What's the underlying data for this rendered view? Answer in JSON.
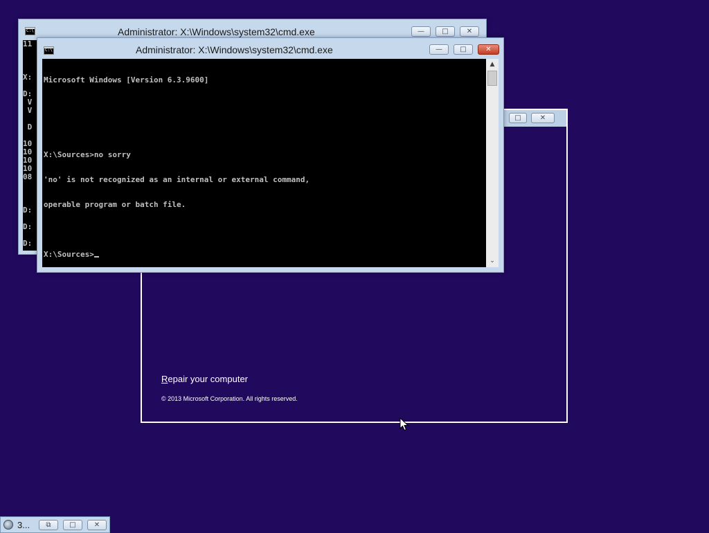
{
  "setup_window": {
    "repair_link_first": "R",
    "repair_link_rest": "epair your computer",
    "copyright": "© 2013 Microsoft Corporation. All rights reserved.",
    "caption_restore": "□",
    "caption_close": "✕"
  },
  "cmd_back": {
    "title": "Administrator: X:\\Windows\\system32\\cmd.exe",
    "icon_text": "C:\\.",
    "console_text": "11\n\n\n\nX:\n\nD:\n V\n V\n\n D\n\n10\n10\n10\n10\n08\n\n\n\nD:\n\nD:\n\nD:",
    "minimize": "—",
    "restore": "□",
    "close": "✕"
  },
  "cmd_front": {
    "title": "Administrator: X:\\Windows\\system32\\cmd.exe",
    "icon_text": "C:\\.",
    "console_lines": [
      "Microsoft Windows [Version 6.3.9600]",
      "",
      "",
      "X:\\Sources>no sorry",
      "'no' is not recognized as an internal or external command,",
      "operable program or batch file.",
      "",
      "X:\\Sources>"
    ],
    "minimize": "—",
    "restore": "□",
    "close": "✕",
    "scroll_up": "▲",
    "scroll_down": "⌄"
  },
  "minimized_window": {
    "label": "3...",
    "restore": "⧉",
    "maximize": "□",
    "close": "✕"
  },
  "colors": {
    "desktop": "#21095e",
    "console_bg": "#000000",
    "console_fg": "#c0c0c0",
    "title_bar": "#c6d8ec"
  }
}
